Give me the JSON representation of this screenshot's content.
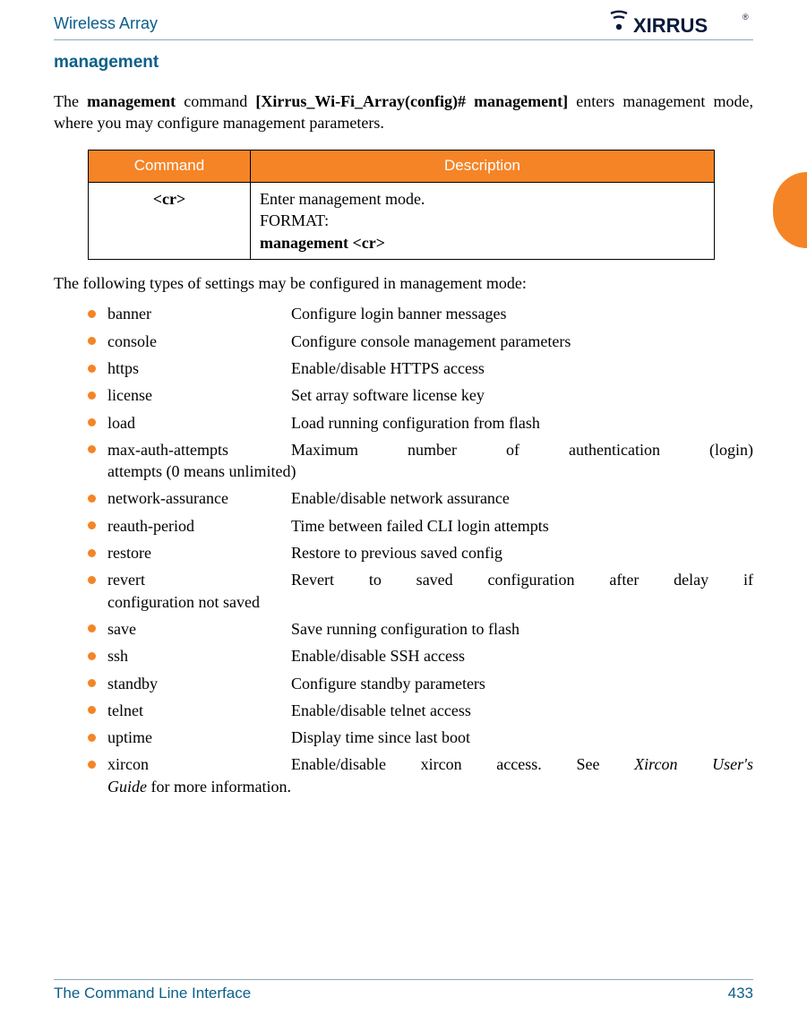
{
  "header": {
    "title": "Wireless Array",
    "logo_text": "XIRRUS"
  },
  "section": {
    "title": "management",
    "intro_pre": "The ",
    "intro_cmd": "management",
    "intro_mid": " command ",
    "intro_bracket": "[Xirrus_Wi-Fi_Array(config)# management]",
    "intro_post": " enters management mode, where you may configure management parameters."
  },
  "table": {
    "headers": {
      "command": "Command",
      "description": "Description"
    },
    "row": {
      "command": "<cr>",
      "desc_line1": "Enter management mode.",
      "desc_line2": "FORMAT:",
      "desc_line3": "management <cr>"
    }
  },
  "following": "The following types of settings may be configured in management mode:",
  "settings": [
    {
      "key": "banner",
      "val": " Configure login banner messages",
      "layout": "two"
    },
    {
      "key": "console",
      "val": "Configure console management parameters",
      "layout": "two"
    },
    {
      "key": "https",
      "val": "Enable/disable HTTPS access",
      "layout": "two"
    },
    {
      "key": "license",
      "val": "Set array software license key",
      "layout": "two"
    },
    {
      "key": "load",
      "val": "Load running configuration from flash",
      "layout": "two"
    },
    {
      "key": "max-auth-attempts",
      "first": "Maximum number of authentication (login)",
      "second": "attempts (0 means unlimited)",
      "layout": "wrap"
    },
    {
      "key": "network-assurance",
      "val": "Enable/disable network assurance",
      "layout": "two"
    },
    {
      "key": "reauth-period",
      "val": "Time between failed CLI login attempts",
      "layout": "two"
    },
    {
      "key": "restore",
      "val": "Restore to previous saved config",
      "layout": "two"
    },
    {
      "key": "revert",
      "first": "Revert to saved configuration after delay if",
      "second": "configuration not saved",
      "layout": "wrap"
    },
    {
      "key": "save",
      "val": "Save running configuration to flash",
      "layout": "two"
    },
    {
      "key": "ssh",
      "val": "Enable/disable SSH access",
      "layout": "two"
    },
    {
      "key": "standby",
      "val": "Configure standby parameters",
      "layout": "two"
    },
    {
      "key": "telnet",
      "val": "Enable/disable telnet access",
      "layout": "two"
    },
    {
      "key": "uptime",
      "val": "Display time since last boot",
      "layout": "two"
    },
    {
      "key": "xircon",
      "first_pre": "Enable/disable xircon access. See ",
      "first_ital": "Xircon User's",
      "second_ital": "Guide",
      "second_post": " for more information.",
      "layout": "xircon"
    }
  ],
  "footer": {
    "section": "The Command Line Interface",
    "page": "433"
  }
}
